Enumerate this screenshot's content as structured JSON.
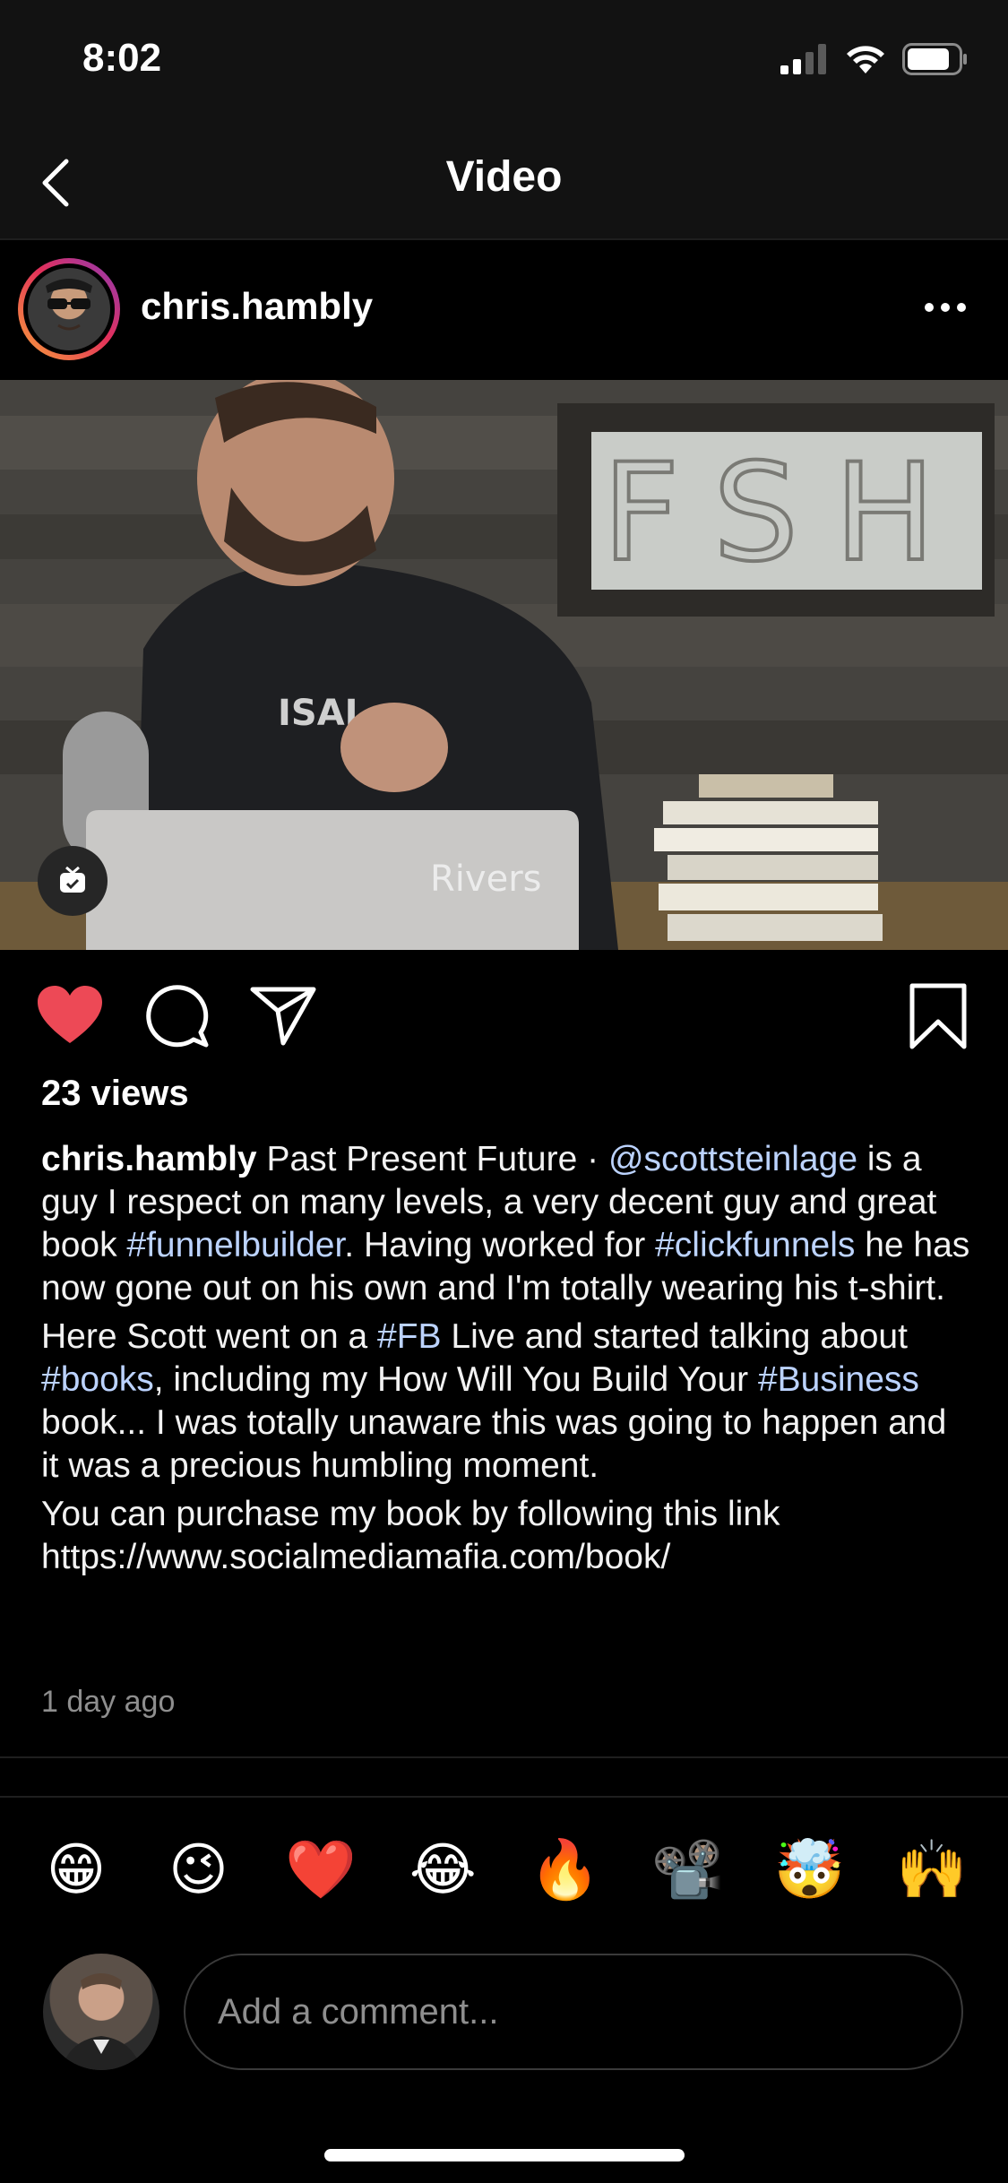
{
  "status_bar": {
    "time": "8:02"
  },
  "nav": {
    "title": "Video"
  },
  "post": {
    "username": "chris.hambly",
    "views": "23 views",
    "caption": {
      "username": "chris.hambly",
      "p1_a": "Past Present Future · ",
      "mention": "@scottsteinlage",
      "p1_b": " is a guy I respect on many levels, a very decent guy and great book ",
      "tag1": "#funnelbuilder",
      "p1_c": ". Having worked for ",
      "tag2": "#clickfunnels",
      "p1_d": " he has now gone out on his own and I'm totally wearing his t-shirt.",
      "p2_a": "Here Scott went on a ",
      "tag3": "#FB",
      "p2_b": " Live and started talking about ",
      "tag4": "#books",
      "p2_c": ", including my How Will You Build Your ",
      "tag5": "#Business",
      "p2_d": " book... I was totally unaware this was going to happen and it was a precious humbling moment.",
      "p3": "You can purchase my book by following this link https://www.socialmediamafia.com/book/"
    },
    "timestamp": "1 day ago",
    "video_text": {
      "sign": "FSH",
      "laptop_logo": "Rivers",
      "shirt": "ISAL"
    }
  },
  "quick_reactions": [
    "😁",
    "😉",
    "❤️",
    "😂",
    "🔥",
    "📽️",
    "🤯",
    "🙌"
  ],
  "comment": {
    "placeholder": "Add a comment..."
  },
  "colors": {
    "like": "#ed4956",
    "link": "#bcd3ff",
    "muted": "#8e8e8e"
  },
  "icons": {
    "back": "chevron-left",
    "more": "ellipsis",
    "like": "heart-filled",
    "comment": "speech-bubble",
    "share": "paper-plane",
    "save": "bookmark",
    "video_badge": "igtv"
  }
}
